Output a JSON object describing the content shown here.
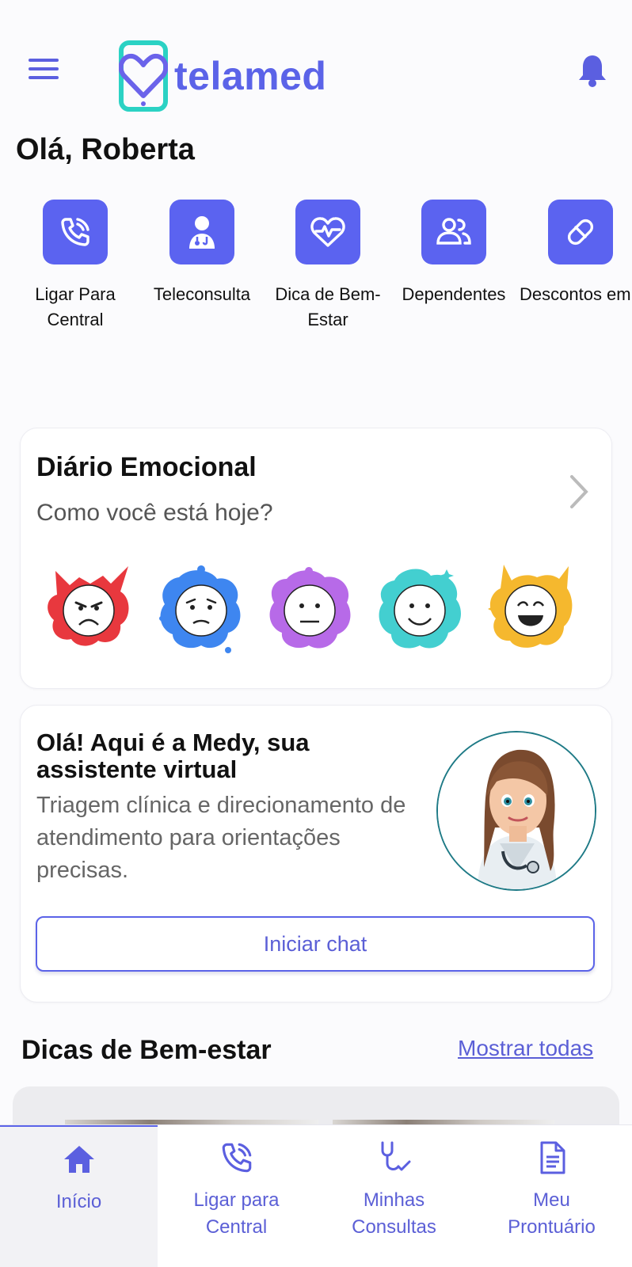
{
  "header": {
    "brand": "telamed",
    "menu_icon": "hamburger-menu-icon",
    "bell_icon": "bell-icon",
    "accent_color": "#5b63e8",
    "logo_color": "#2bd2c4"
  },
  "greeting": "Olá, Roberta",
  "shortcuts": [
    {
      "label": "Ligar Para Central",
      "icon": "phone-call-icon"
    },
    {
      "label": "Teleconsulta",
      "icon": "doctor-icon"
    },
    {
      "label": "Dica de Bem-Estar",
      "icon": "heart-pulse-icon"
    },
    {
      "label": "Dependentes",
      "icon": "users-icon"
    },
    {
      "label": "Descontos em Medicamentos",
      "icon": "pill-icon"
    }
  ],
  "diary": {
    "title": "Diário Emocional",
    "subtitle": "Como você está hoje?",
    "moods": [
      "angry",
      "sad",
      "neutral",
      "happy",
      "very-happy"
    ]
  },
  "medy": {
    "title": "Olá! Aqui é a Medy, sua assistente virtual",
    "description": "Triagem clínica e direcionamento de atendimento para orientações precisas.",
    "button": "Iniciar chat"
  },
  "tips": {
    "title": "Dicas de Bem-estar",
    "link": "Mostrar todas"
  },
  "bottom_nav": [
    {
      "label": "Início",
      "icon": "home-icon",
      "active": true
    },
    {
      "label": "Ligar para Central",
      "icon": "phone-call-icon",
      "active": false
    },
    {
      "label": "Minhas Consultas",
      "icon": "stethoscope-icon",
      "active": false
    },
    {
      "label": "Meu Prontuário",
      "icon": "document-icon",
      "active": false
    }
  ]
}
